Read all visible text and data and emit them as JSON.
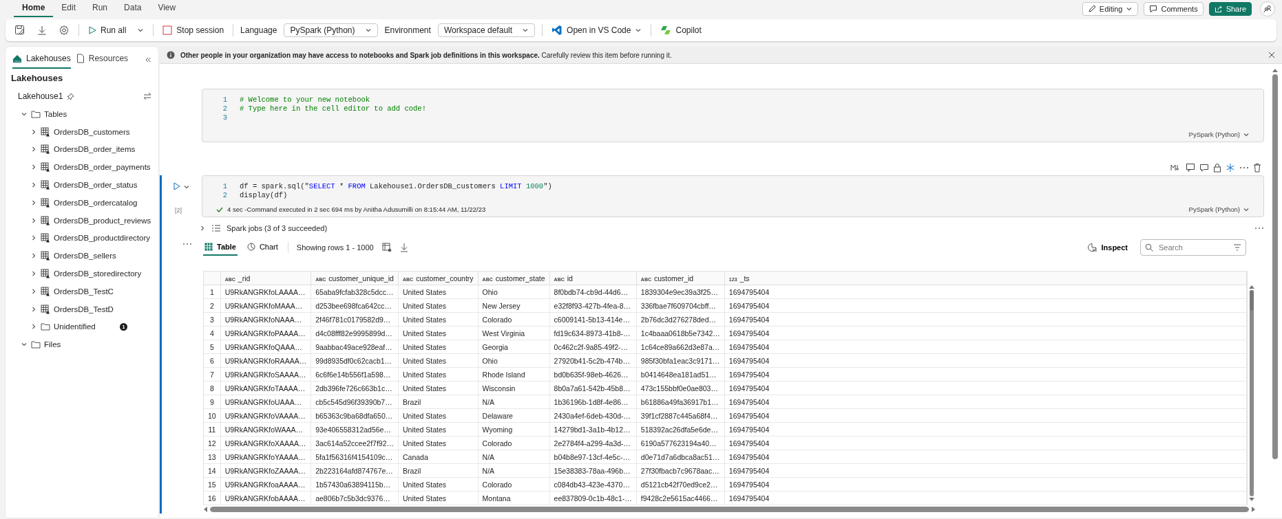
{
  "menu_tabs": [
    {
      "label": "Home",
      "selected": true
    },
    {
      "label": "Edit",
      "selected": false
    },
    {
      "label": "Run",
      "selected": false
    },
    {
      "label": "Data",
      "selected": false
    },
    {
      "label": "View",
      "selected": false
    }
  ],
  "header_buttons": {
    "editing": "Editing",
    "comments": "Comments",
    "share": "Share"
  },
  "toolbar": {
    "run_all": "Run all",
    "stop_session": "Stop session",
    "language_label": "Language",
    "language": "PySpark (Python)",
    "environment_label": "Environment",
    "environment": "Workspace default",
    "open_vscode": "Open in VS Code",
    "copilot": "Copilot"
  },
  "sidebar": {
    "tabs": [
      {
        "label": "Lakehouses",
        "selected": true
      },
      {
        "label": "Resources",
        "selected": false
      }
    ],
    "heading": "Lakehouses",
    "lakehouse": "Lakehouse1",
    "tree": [
      {
        "label": "Tables",
        "kind": "folder",
        "expanded": true,
        "children": [
          {
            "label": "OrdersDB_customers",
            "kind": "table",
            "expanded": false
          },
          {
            "label": "OrdersDB_order_items",
            "kind": "table",
            "expanded": false
          },
          {
            "label": "OrdersDB_order_payments",
            "kind": "table",
            "expanded": false
          },
          {
            "label": "OrdersDB_order_status",
            "kind": "table",
            "expanded": false
          },
          {
            "label": "OrdersDB_ordercatalog",
            "kind": "table",
            "expanded": false
          },
          {
            "label": "OrdersDB_product_reviews",
            "kind": "table",
            "expanded": false
          },
          {
            "label": "OrdersDB_productdirectory",
            "kind": "table",
            "expanded": false
          },
          {
            "label": "OrdersDB_sellers",
            "kind": "table",
            "expanded": false
          },
          {
            "label": "OrdersDB_storedirectory",
            "kind": "table",
            "expanded": false
          },
          {
            "label": "OrdersDB_TestC",
            "kind": "table",
            "expanded": false
          },
          {
            "label": "OrdersDB_TestD",
            "kind": "table",
            "expanded": false
          },
          {
            "label": "Unidentified",
            "kind": "folder",
            "expanded": false,
            "badge": "1"
          }
        ]
      },
      {
        "label": "Files",
        "kind": "folder",
        "expanded": true
      }
    ]
  },
  "banner": "**Other people in your organization may have access to notebooks and Spark job definitions in this workspace.** Carefully review this item before running it.",
  "cells": [
    {
      "selected": false,
      "language": "PySpark (Python)",
      "lines": [
        {
          "number": "1",
          "tokens": [
            {
              "kind": "comment",
              "text": "# Welcome to your new notebook"
            }
          ]
        },
        {
          "number": "2",
          "tokens": [
            {
              "kind": "comment",
              "text": "# Type here in the cell editor to add code!"
            }
          ]
        },
        {
          "number": "3"
        }
      ]
    },
    {
      "selected": true,
      "language": "PySpark (Python)",
      "execution_count": "[2]",
      "status": "4 sec -Command executed in 2 sec 694 ms by Anitha Adusumilli on 8:15:44 AM, 11/22/23",
      "lines": [
        {
          "number": "1",
          "tokens": [
            {
              "kind": "plain",
              "text": "df = spark.sql(\""
            },
            {
              "kind": "keyword",
              "text": "SELECT"
            },
            {
              "kind": "plain",
              "text": " * "
            },
            {
              "kind": "keyword",
              "text": "FROM"
            },
            {
              "kind": "plain",
              "text": " Lakehouse1.OrdersDB_customers "
            },
            {
              "kind": "keyword",
              "text": "LIMIT"
            },
            {
              "kind": "number",
              "text": " 1000"
            },
            {
              "kind": "plain",
              "text": "\")"
            }
          ]
        },
        {
          "number": "2",
          "tokens": [
            {
              "kind": "plain",
              "text": "display(df)"
            }
          ]
        }
      ]
    }
  ],
  "spark_jobs": "Spark jobs (3 of 3 succeeded)",
  "output": {
    "tabs": [
      {
        "label": "Table",
        "selected": true
      },
      {
        "label": "Chart",
        "selected": false
      }
    ],
    "rows_info": "Showing rows 1 - 1000",
    "inspect": "Inspect",
    "search": {
      "placeholder": "Search"
    }
  },
  "table": {
    "columns": [
      {
        "type": "ABC",
        "name": "_rid"
      },
      {
        "type": "ABC",
        "name": "customer_unique_id"
      },
      {
        "type": "ABC",
        "name": "customer_country"
      },
      {
        "type": "ABC",
        "name": "customer_state"
      },
      {
        "type": "ABC",
        "name": "id"
      },
      {
        "type": "ABC",
        "name": "customer_id"
      },
      {
        "type": "123",
        "name": "_ts"
      }
    ],
    "rows": [
      {
        "number": "1",
        "cells": [
          "U9RkANGRKfoLAAAA…",
          "65aba9fcfab328c5dcc…",
          "United States",
          "Ohio",
          "8f0bdb74-cb9d-44d6…",
          "1839304e9ec39a3f25…",
          "1694795404"
        ]
      },
      {
        "number": "2",
        "cells": [
          "U9RkANGRKfoMAAA…",
          "d253bee698fca642cc…",
          "United States",
          "New Jersey",
          "e32f8f93-427b-4fea-8…",
          "336fbae7f609704cbff…",
          "1694795404"
        ]
      },
      {
        "number": "3",
        "cells": [
          "U9RkANGRKfoNAAA…",
          "2f46f781c0179582d9…",
          "United States",
          "Colorado",
          "c6009141-5b13-414e…",
          "2b76dc3d276278ded…",
          "1694795404"
        ]
      },
      {
        "number": "4",
        "cells": [
          "U9RkANGRKfoPAAAA…",
          "d4c08fff82e9995899d…",
          "United States",
          "West Virginia",
          "fd19c634-8973-41b8-…",
          "1c4baaa0618b5e7342…",
          "1694795404"
        ]
      },
      {
        "number": "5",
        "cells": [
          "U9RkANGRKfoQAAA…",
          "9aabbac49ace928eaf…",
          "United States",
          "Georgia",
          "0c462c2f-9a85-49f2-…",
          "1c64ce89a662d3e87a…",
          "1694795404"
        ]
      },
      {
        "number": "6",
        "cells": [
          "U9RkANGRKfoRAAAA…",
          "99d8935df0c62cacb1…",
          "United States",
          "Ohio",
          "27920b41-5c2b-474b…",
          "985f30bfa1eac3c9171…",
          "1694795404"
        ]
      },
      {
        "number": "7",
        "cells": [
          "U9RkANGRKfoSAAAA…",
          "6c6f6e14b556f1a598…",
          "United States",
          "Rhode Island",
          "bd0b635f-98eb-4626…",
          "b0414648ea181ad51…",
          "1694795404"
        ]
      },
      {
        "number": "8",
        "cells": [
          "U9RkANGRKfoTAAAA…",
          "2db396fe726c663b1c…",
          "United States",
          "Wisconsin",
          "8b0a7a61-542b-45b8…",
          "473c155bbf0e0ae803…",
          "1694795404"
        ]
      },
      {
        "number": "9",
        "cells": [
          "U9RkANGRKfoUAAA…",
          "cb5c545d96f39390b7…",
          "Brazil",
          "N/A",
          "1b36196b-1d8f-4e86…",
          "b61886a49fa36917b1…",
          "1694795404"
        ]
      },
      {
        "number": "10",
        "cells": [
          "U9RkANGRKfoVAAAA…",
          "b65363c9ba68dfa650…",
          "United States",
          "Delaware",
          "2430a4ef-6deb-430d-…",
          "39f1cf2887c445a68f4…",
          "1694795404"
        ]
      },
      {
        "number": "11",
        "cells": [
          "U9RkANGRKfoWAAA…",
          "93e406558312ad56e…",
          "United States",
          "Wyoming",
          "14279bd1-3a1b-4b12…",
          "518392ac26dfa5e6de…",
          "1694795404"
        ]
      },
      {
        "number": "12",
        "cells": [
          "U9RkANGRKfoXAAAA…",
          "3ac614a52ccee2f7f92…",
          "United States",
          "Colorado",
          "2e2784f4-a299-4a3d-…",
          "6190a577623194a40…",
          "1694795404"
        ]
      },
      {
        "number": "13",
        "cells": [
          "U9RkANGRKfoYAAAA…",
          "5fa1f56316f4154109c…",
          "Canada",
          "N/A",
          "b04b8e97-13cf-4e5c-…",
          "d0e71d7a6dbca8ac51…",
          "1694795404"
        ]
      },
      {
        "number": "14",
        "cells": [
          "U9RkANGRKfoZAAAA…",
          "2b223164afd874767e…",
          "Brazil",
          "N/A",
          "15e38383-78aa-496b…",
          "27f30fbacb7c9678aac…",
          "1694795404"
        ]
      },
      {
        "number": "15",
        "cells": [
          "U9RkANGRKfoaAAAA…",
          "1b57430a63894115b…",
          "United States",
          "Colorado",
          "c084db43-423e-4370…",
          "d5121cb42f70ed9ce2…",
          "1694795404"
        ]
      },
      {
        "number": "16",
        "cells": [
          "U9RkANGRKfobAAAA…",
          "ae806b7c5b3dc9376…",
          "United States",
          "Montana",
          "ee837809-0c1b-48c1-…",
          "f9428c2e5615ac4466…",
          "1694795404"
        ]
      }
    ]
  }
}
